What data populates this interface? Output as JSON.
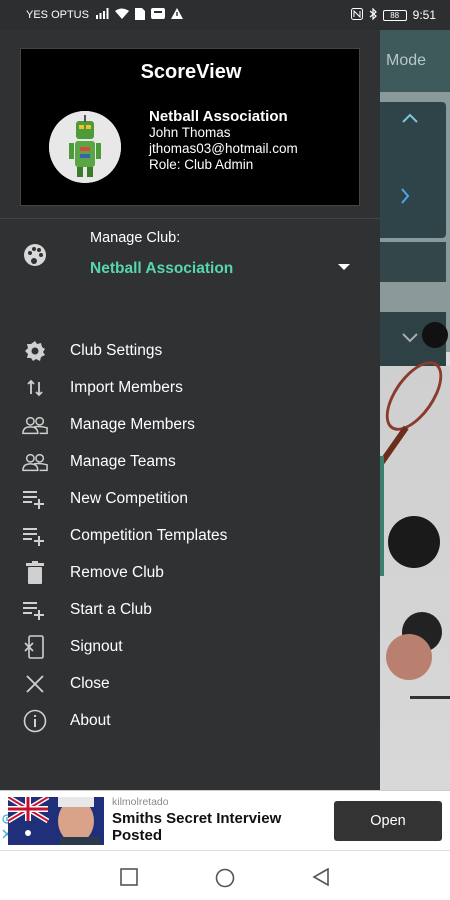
{
  "status_bar": {
    "carrier": "YES OPTUS",
    "battery": "88",
    "time": "9:51",
    "icons": [
      "signal-icon",
      "wifi-icon",
      "sim-icon",
      "storage-icon",
      "warning-icon",
      "nfc-icon",
      "bluetooth-icon",
      "battery-icon"
    ]
  },
  "background_app": {
    "top_right_text": "Mode"
  },
  "drawer": {
    "app_title": "ScoreView",
    "organization": "Netball Association",
    "user_name": "John Thomas",
    "email": "jthomas03@hotmail.com",
    "role": "Role: Club Admin",
    "manage_club": {
      "label": "Manage Club:",
      "selected": "Netball Association"
    },
    "menu": [
      {
        "label": "Club Settings",
        "icon": "gear-icon"
      },
      {
        "label": "Import Members",
        "icon": "swap-vertical-icon"
      },
      {
        "label": "Manage Members",
        "icon": "people-icon"
      },
      {
        "label": "Manage Teams",
        "icon": "people-icon"
      },
      {
        "label": "New Competition",
        "icon": "playlist-add-icon"
      },
      {
        "label": "Competition Templates",
        "icon": "playlist-add-icon"
      },
      {
        "label": "Remove Club",
        "icon": "trash-icon"
      },
      {
        "label": "Start a Club",
        "icon": "playlist-add-icon"
      },
      {
        "label": "Signout",
        "icon": "exit-icon"
      },
      {
        "label": "Close",
        "icon": "close-icon"
      },
      {
        "label": "About",
        "icon": "info-icon"
      }
    ],
    "accent_color": "#57d6ae"
  },
  "ad": {
    "source": "kilmolretado",
    "title": "Smiths Secret Interview Posted",
    "button": "Open"
  },
  "nav": {
    "buttons": [
      "recents-icon",
      "home-icon",
      "back-icon"
    ]
  }
}
